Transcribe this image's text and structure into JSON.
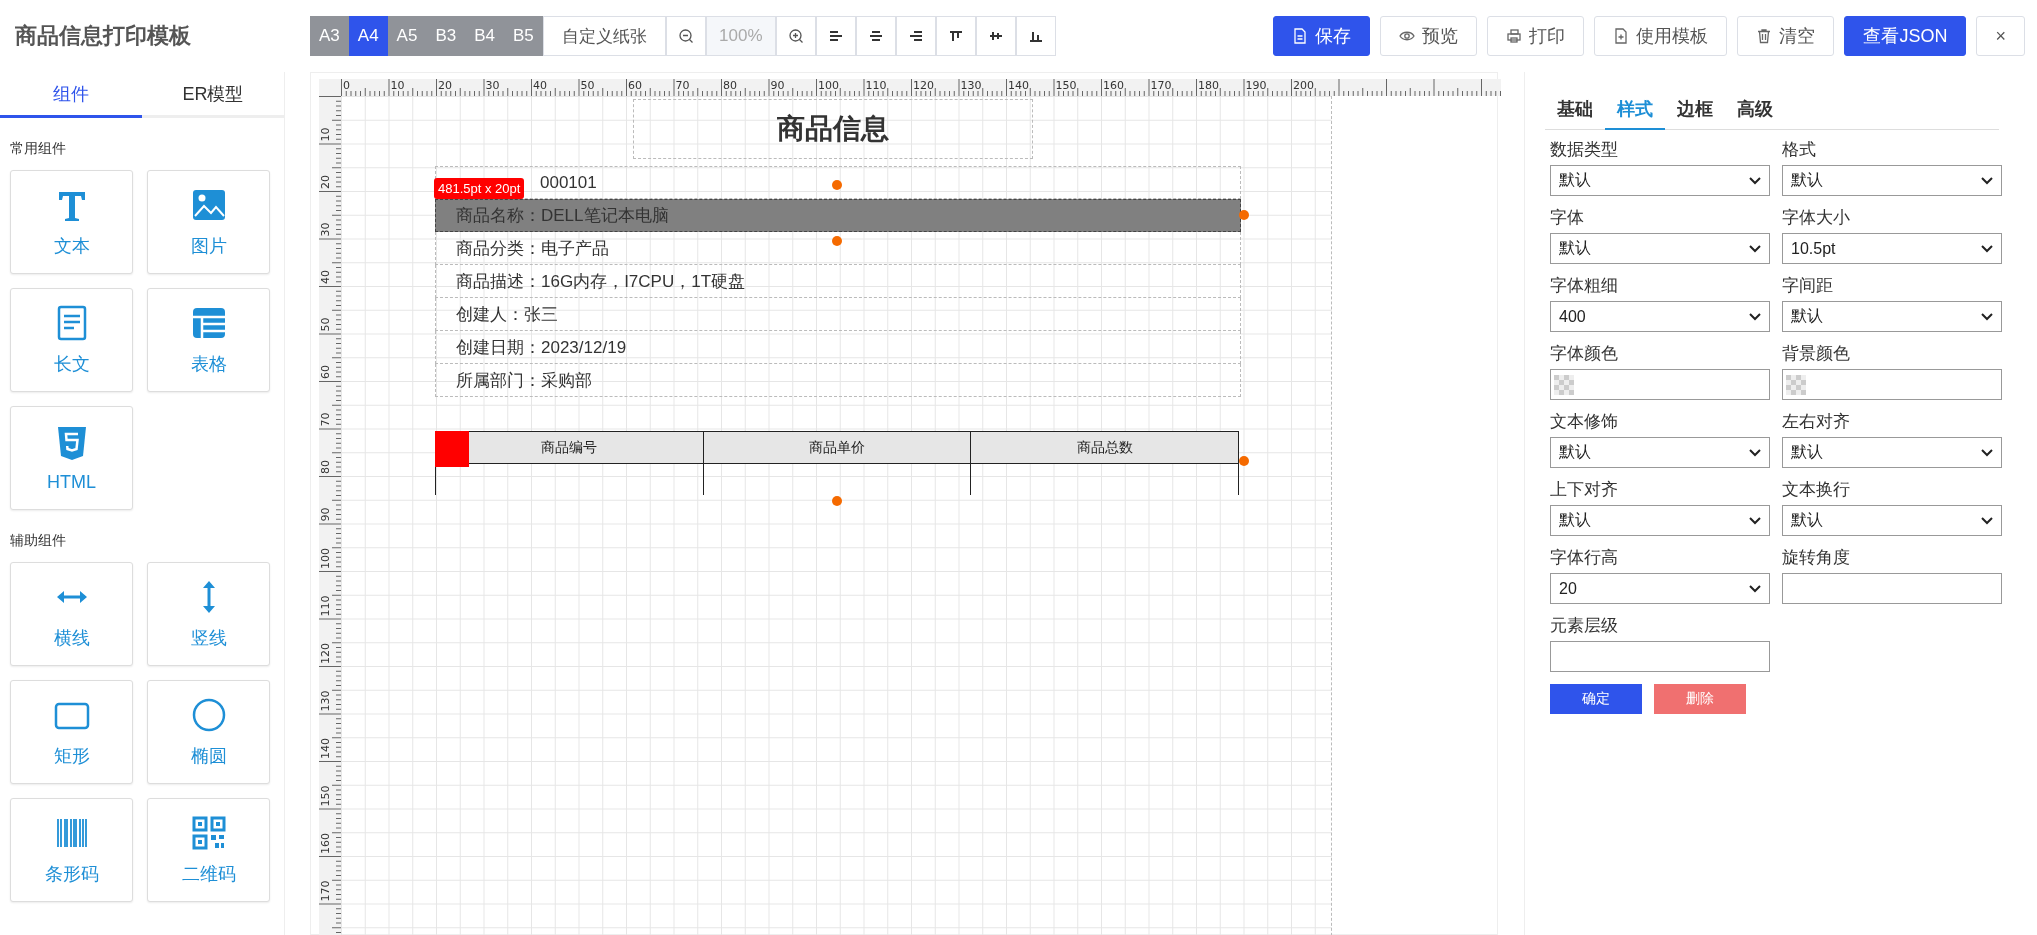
{
  "app_title": "商品信息打印模板",
  "paper_sizes": [
    {
      "label": "A3",
      "selected": false
    },
    {
      "label": "A4",
      "selected": true
    },
    {
      "label": "A5",
      "selected": false
    },
    {
      "label": "B3",
      "selected": false
    },
    {
      "label": "B4",
      "selected": false
    },
    {
      "label": "B5",
      "selected": false
    }
  ],
  "custom_paper": "自定义纸张",
  "zoom": {
    "value": "100%",
    "disabled": true
  },
  "actions": [
    {
      "label": "保存",
      "kind": "primary"
    },
    {
      "label": "预览",
      "kind": "default"
    },
    {
      "label": "打印",
      "kind": "default"
    },
    {
      "label": "使用模板",
      "kind": "default"
    },
    {
      "label": "清空",
      "kind": "default"
    },
    {
      "label": "查看JSON",
      "kind": "primary"
    },
    {
      "label": "×",
      "kind": "default"
    }
  ],
  "left_tabs": [
    {
      "label": "组件",
      "selected": true
    },
    {
      "label": "ER模型",
      "selected": false
    }
  ],
  "component_groups": [
    {
      "title": "常用组件",
      "items": [
        "文本",
        "图片",
        "长文",
        "表格",
        "HTML"
      ]
    },
    {
      "title": "辅助组件",
      "items": [
        "横线",
        "竖线",
        "矩形",
        "椭圆",
        "条形码",
        "二维码"
      ]
    }
  ],
  "canvas": {
    "ruler": {
      "x_labels": [
        "0",
        "10",
        "20",
        "30",
        "40",
        "50",
        "60",
        "70",
        "80",
        "90",
        "100",
        "110",
        "120",
        "130",
        "140",
        "150",
        "160",
        "170",
        "180",
        "190",
        "200"
      ],
      "y_labels": [
        "10",
        "20",
        "30",
        "40",
        "50",
        "60",
        "70",
        "80",
        "90",
        "100",
        "110",
        "120",
        "130",
        "140",
        "150",
        "160",
        "170"
      ]
    },
    "title": "商品信息",
    "size_badge": "481.5pt x 20pt",
    "fields": [
      {
        "text": "000101",
        "selected": false
      },
      {
        "text": "商品名称：DELL笔记本电脑",
        "selected": true
      },
      {
        "text": "商品分类：电子产品",
        "selected": false
      },
      {
        "text": "商品描述：16G内存，I7CPU，1T硬盘",
        "selected": false
      },
      {
        "text": "创建人：张三",
        "selected": false
      },
      {
        "text": "创建日期：2023/12/19",
        "selected": false
      },
      {
        "text": "所属部门：采购部",
        "selected": false
      }
    ],
    "table": {
      "columns": [
        "商品编号",
        "商品单价",
        "商品总数"
      ]
    }
  },
  "properties": {
    "tabs": [
      {
        "label": "基础",
        "selected": false
      },
      {
        "label": "样式",
        "selected": true
      },
      {
        "label": "边框",
        "selected": false
      },
      {
        "label": "高级",
        "selected": false
      }
    ],
    "fields": [
      {
        "label": "数据类型",
        "kind": "select",
        "value": "默认"
      },
      {
        "label": "格式",
        "kind": "select",
        "value": "默认"
      },
      {
        "label": "字体",
        "kind": "select",
        "value": "默认"
      },
      {
        "label": "字体大小",
        "kind": "select",
        "value": "10.5pt"
      },
      {
        "label": "字体粗细",
        "kind": "select",
        "value": "400"
      },
      {
        "label": "字间距",
        "kind": "select",
        "value": "默认"
      },
      {
        "label": "字体颜色",
        "kind": "color"
      },
      {
        "label": "背景颜色",
        "kind": "color"
      },
      {
        "label": "文本修饰",
        "kind": "select",
        "value": "默认"
      },
      {
        "label": "左右对齐",
        "kind": "select",
        "value": "默认"
      },
      {
        "label": "上下对齐",
        "kind": "select",
        "value": "默认"
      },
      {
        "label": "文本换行",
        "kind": "select",
        "value": "默认"
      },
      {
        "label": "字体行高",
        "kind": "select",
        "value": "20"
      },
      {
        "label": "旋转角度",
        "kind": "input"
      },
      {
        "label": "元素层级",
        "kind": "input"
      }
    ],
    "buttons": [
      {
        "label": "确定",
        "kind": "primary"
      },
      {
        "label": "删除",
        "kind": "danger"
      }
    ]
  }
}
